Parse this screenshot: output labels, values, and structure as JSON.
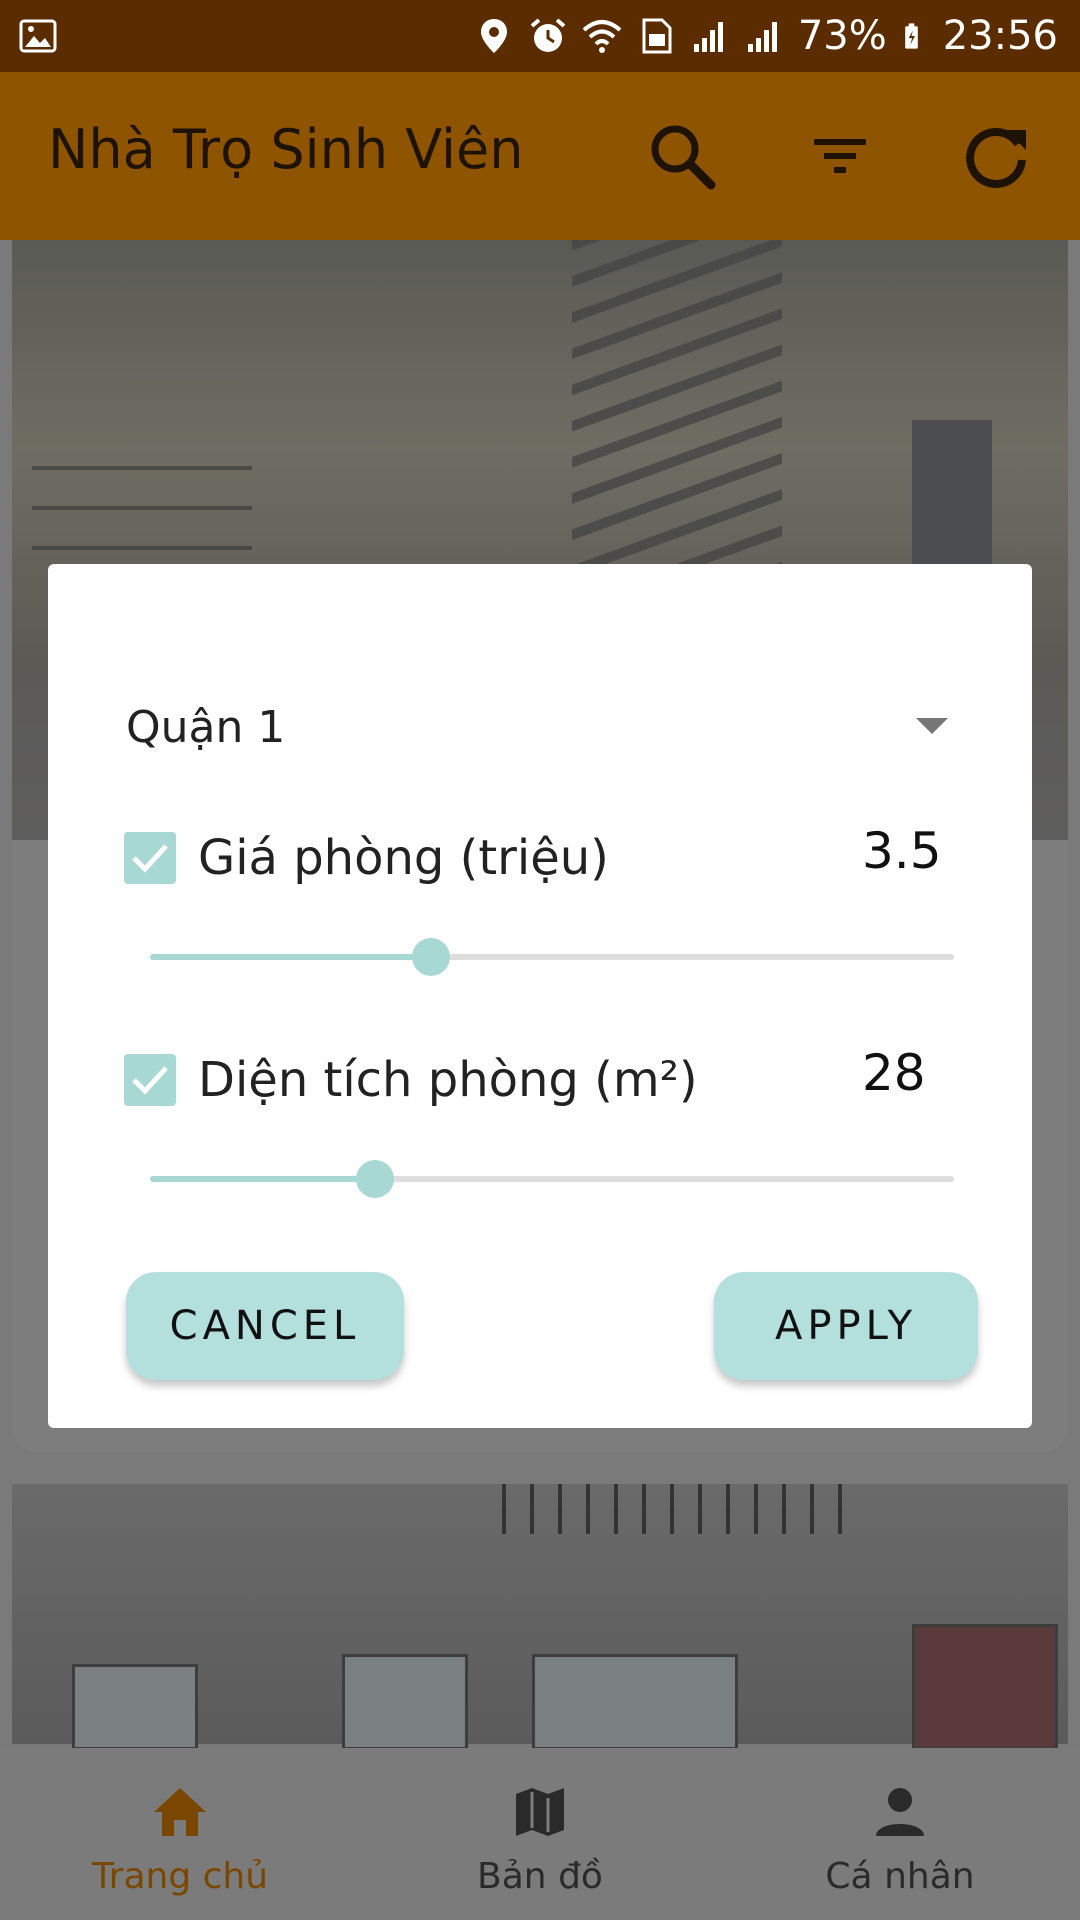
{
  "status_bar": {
    "battery": "73%",
    "time": "23:56"
  },
  "app_bar": {
    "title": "Nhà Trọ Sinh Viên",
    "actions": [
      "search-icon",
      "filter-icon",
      "refresh-icon"
    ]
  },
  "filter_dialog": {
    "district": "Quận 1",
    "price": {
      "label": "Giá phòng (triệu)",
      "checked": true,
      "value": "3.5",
      "slider_fraction": 0.35
    },
    "area": {
      "label": "Diện tích phòng (m²)",
      "checked": true,
      "value": "28",
      "slider_fraction": 0.28
    },
    "cancel_label": "CANCEL",
    "apply_label": "APPLY"
  },
  "bottom_nav": {
    "items": [
      {
        "label": "Trang chủ",
        "icon": "home-icon",
        "active": true
      },
      {
        "label": "Bản đồ",
        "icon": "map-icon",
        "active": false
      },
      {
        "label": "Cá nhân",
        "icon": "person-icon",
        "active": false
      }
    ]
  },
  "colors": {
    "appbar": "#8f5400",
    "statusbar": "#5a2c00",
    "accent": "#a8d8d4",
    "active_nav": "#7a4700"
  }
}
